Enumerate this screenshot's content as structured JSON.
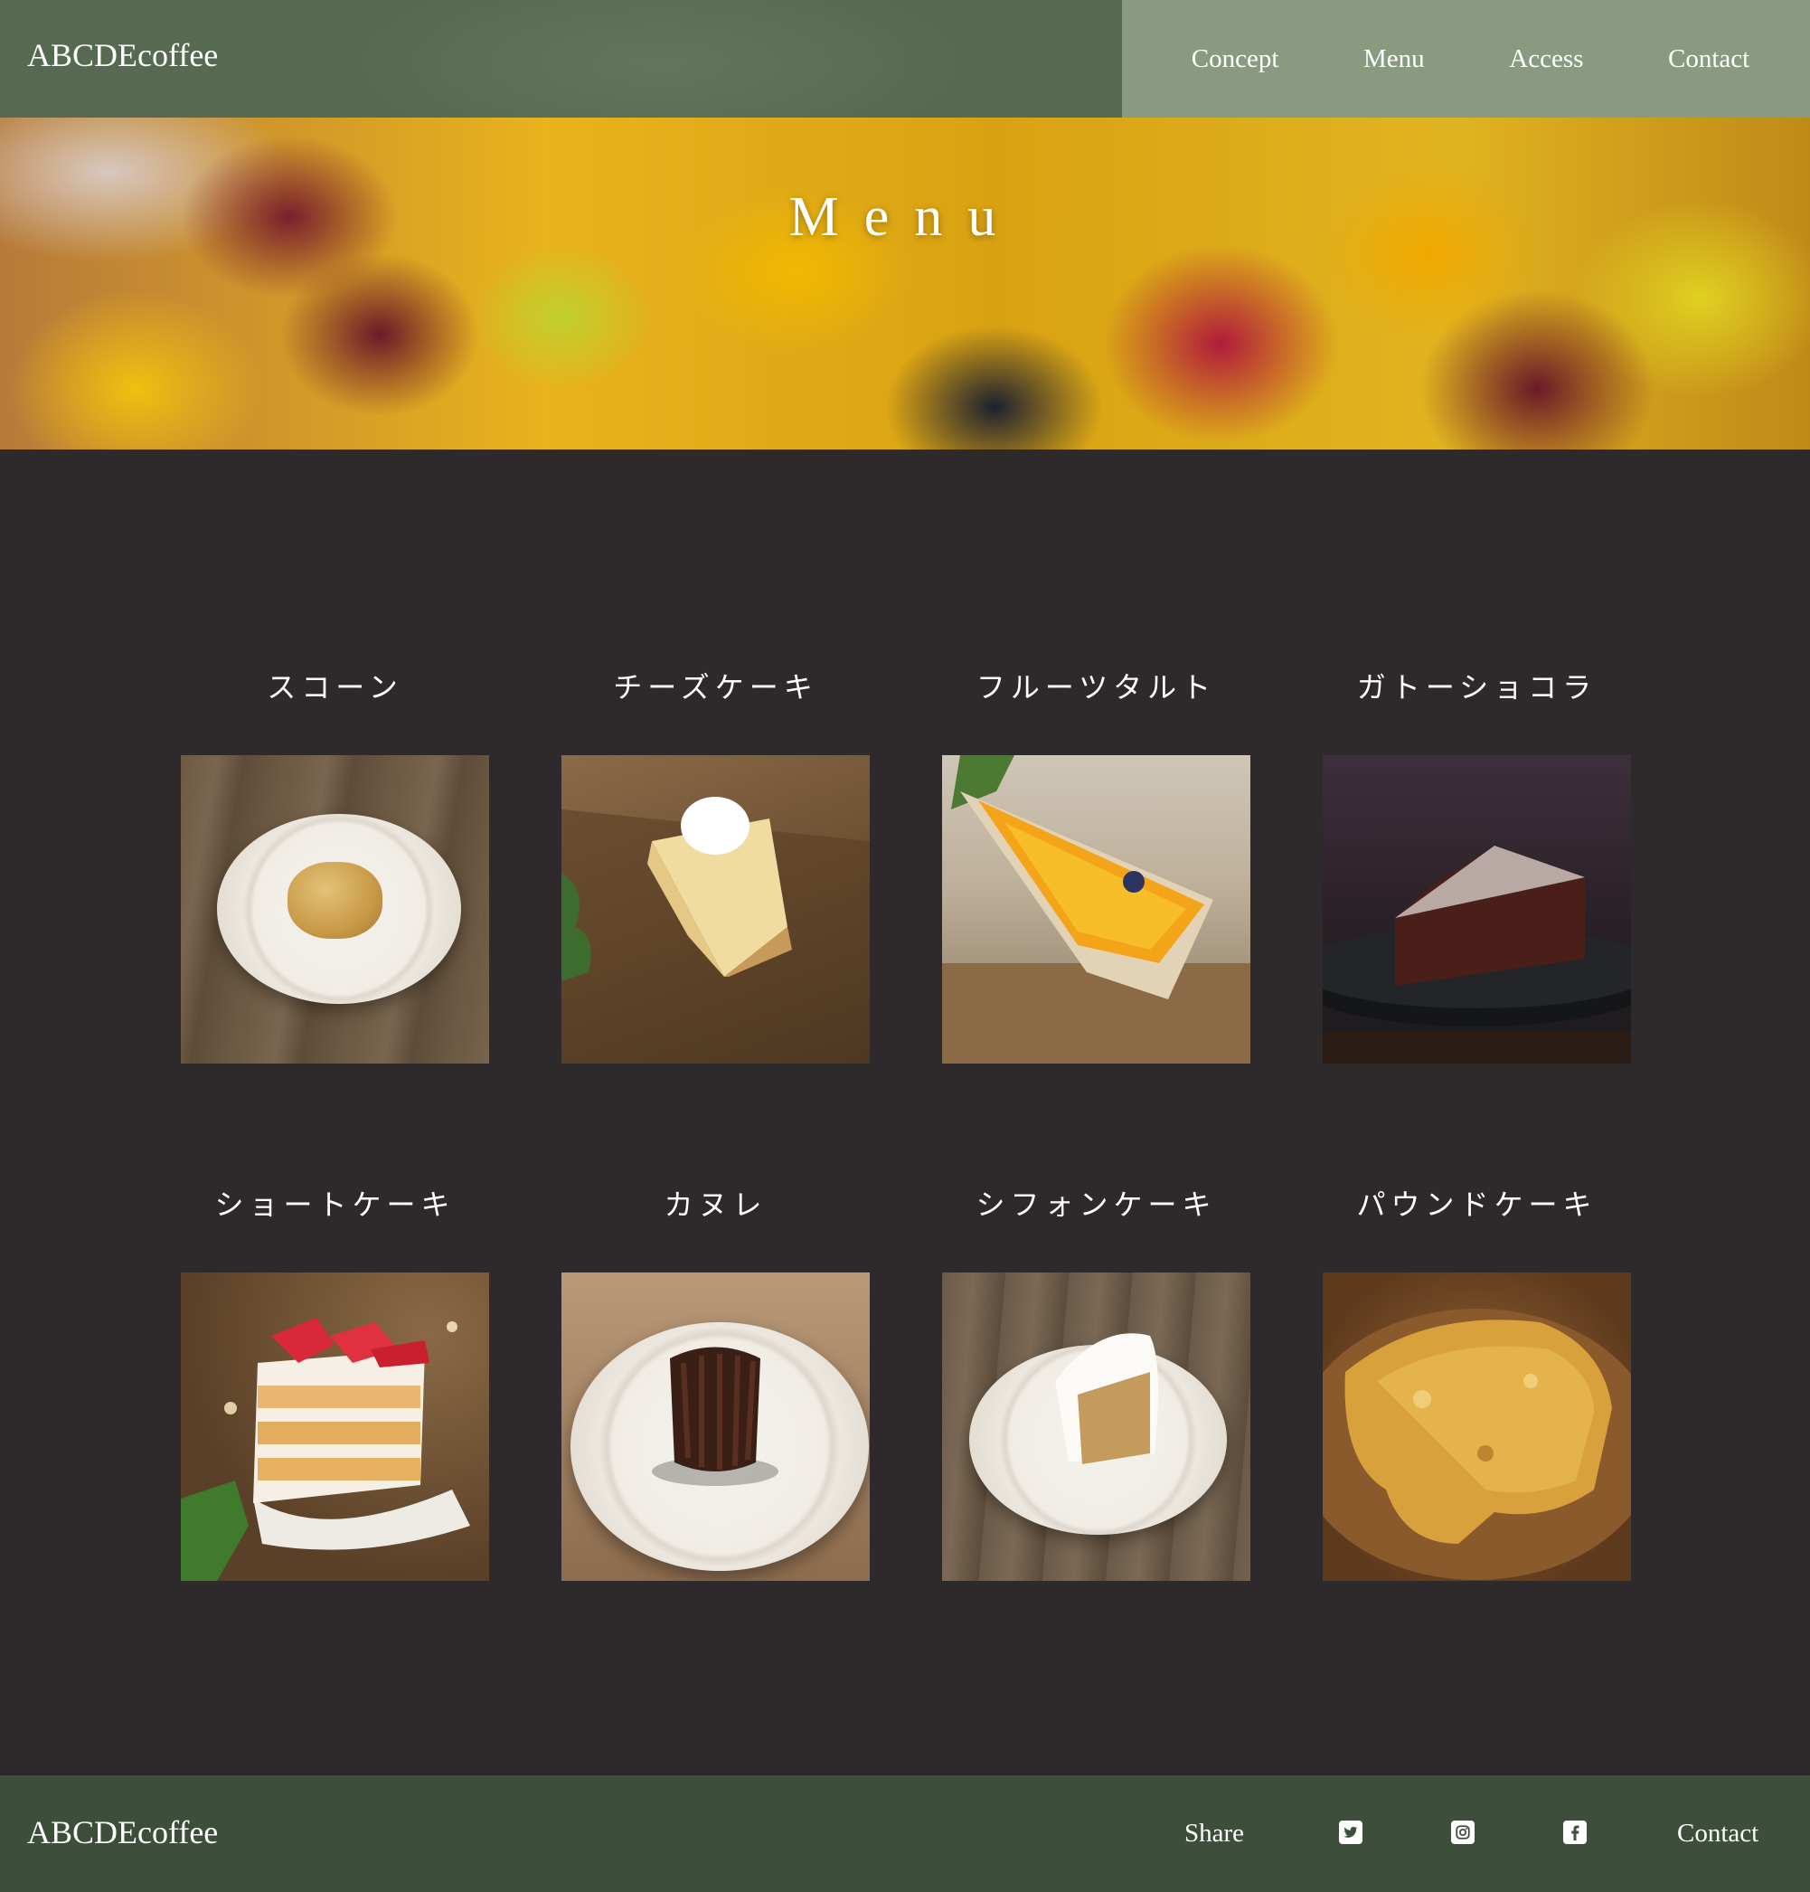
{
  "header": {
    "logo": "ABCDEcoffee",
    "nav": [
      "Concept",
      "Menu",
      "Access",
      "Contact"
    ]
  },
  "hero": {
    "title": "Menu"
  },
  "menu": {
    "items": [
      {
        "name": "スコーン",
        "photo": "scone"
      },
      {
        "name": "チーズケーキ",
        "photo": "cheesecake"
      },
      {
        "name": "フルーツタルト",
        "photo": "fruit-tart"
      },
      {
        "name": "ガトーショコラ",
        "photo": "gateau-chocolat"
      },
      {
        "name": "ショートケーキ",
        "photo": "shortcake"
      },
      {
        "name": "カヌレ",
        "photo": "canele"
      },
      {
        "name": "シフォンケーキ",
        "photo": "chiffon-cake"
      },
      {
        "name": "パウンドケーキ",
        "photo": "pound-cake"
      }
    ]
  },
  "footer": {
    "logo": "ABCDEcoffee",
    "share_label": "Share",
    "social_icons": [
      "twitter-icon",
      "instagram-icon",
      "facebook-icon"
    ],
    "contact_label": "Contact"
  },
  "colors": {
    "header_left": "#566a52",
    "header_right": "#8a9a80",
    "background": "#2e2a2b",
    "footer": "#3d4f3b"
  }
}
